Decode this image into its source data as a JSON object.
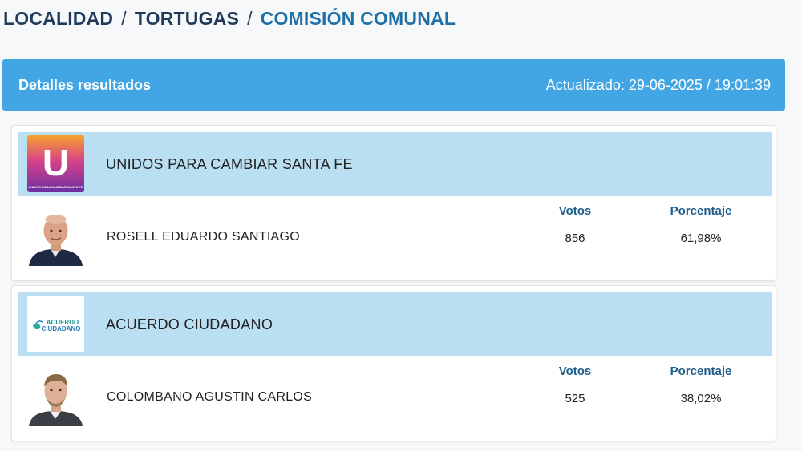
{
  "breadcrumb": {
    "items": [
      "LOCALIDAD",
      "TORTUGAS",
      "COMISIÓN COMUNAL"
    ],
    "separator": "/"
  },
  "header": {
    "title": "Detalles resultados",
    "updated": "Actualizado: 29-06-2025 / 19:01:39"
  },
  "results": [
    {
      "party": "UNIDOS PARA CAMBIAR SANTA FE",
      "logo_text": "U",
      "logo_caption": "UNIDOS PARA CAMBIAR SANTA FE",
      "candidate": "ROSELL EDUARDO SANTIAGO",
      "votes_label": "Votos",
      "pct_label": "Porcentaje",
      "votes": "856",
      "percentage": "61,98%"
    },
    {
      "party": "ACUERDO CIUDADANO",
      "logo_text_1": "ACUERDO",
      "logo_text_2": "CIUDADANO",
      "candidate": "COLOMBANO AGUSTIN CARLOS",
      "votes_label": "Votos",
      "pct_label": "Porcentaje",
      "votes": "525",
      "percentage": "38,02%"
    }
  ],
  "colors": {
    "header": "#41a6e3",
    "party_row": "#bbdff2",
    "breadcrumb_active": "#1d6fa8",
    "breadcrumb": "#1f3a5a"
  }
}
